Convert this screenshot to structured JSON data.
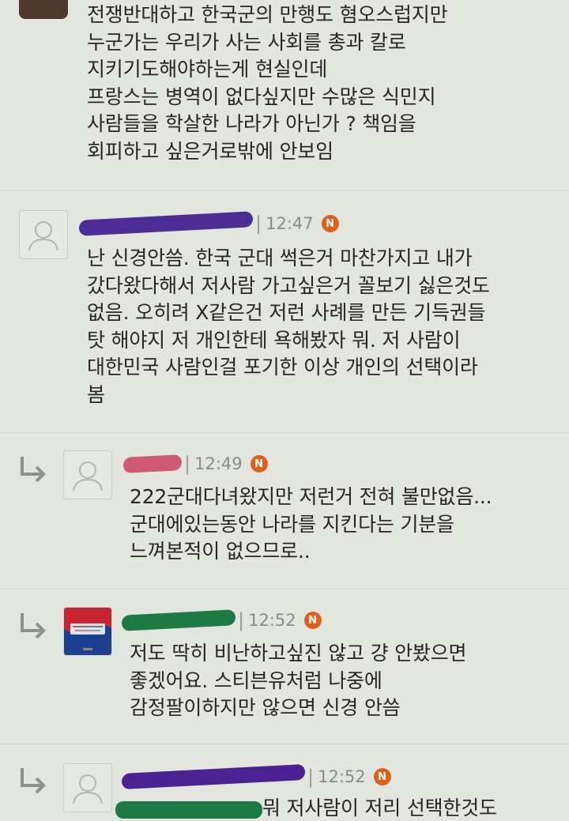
{
  "comments": [
    {
      "type": "comment",
      "avatar": "photo",
      "lines": [
        "전쟁반대하고 한국군의 만행도 혐오스럽지만",
        "누군가는 우리가 사는 사회를 총과 칼로",
        "지키기도해야하는게 현실인데",
        "프랑스는 병역이 없다싶지만 수많은 식민지",
        "사람들을 학살한 나라가 아닌가 ? 책임을",
        "회피하고 싶은거로밖에 안보임"
      ]
    },
    {
      "type": "comment",
      "avatar": "default",
      "time": "12:47",
      "badge": "N",
      "redact_color": "#4c2c95",
      "lines": [
        "난 신경안씀. 한국 군대 썩은거 마찬가지고 내가",
        "갔다왔다해서 저사람 가고싶은거 꼴보기 싫은것도",
        "없음. 오히려 X같은건 저런 사례를 만든 기득권들",
        "탓 해야지 저 개인한테 욕해봤자 뭐. 저 사람이",
        "대한민국 사람인걸 포기한 이상 개인의 선택이라",
        "봄"
      ]
    },
    {
      "type": "reply",
      "avatar": "default",
      "time": "12:49",
      "badge": "N",
      "redact_color": "#d05a72",
      "lines": [
        "222군대다녀왔지만 저런거 전혀 불만없음...",
        "군대에있는동안 나라를 지킨다는 기분을",
        "느껴본적이 없으므로.."
      ]
    },
    {
      "type": "reply",
      "avatar": "flag",
      "time": "12:52",
      "badge": "N",
      "redact_color": "#1e7a45",
      "lines": [
        "저도 딱히 비난하고싶진 않고 걍 안봤으면",
        "좋겠어요. 스티븐유처럼 나중에",
        "감정팔이하지만 않으면 신경 안씀"
      ]
    },
    {
      "type": "reply",
      "avatar": "default",
      "time": "12:52",
      "badge": "N",
      "redact_color": "#4a2292",
      "lines": [
        "뭐 저사람이 저리 선택한것도"
      ]
    }
  ]
}
